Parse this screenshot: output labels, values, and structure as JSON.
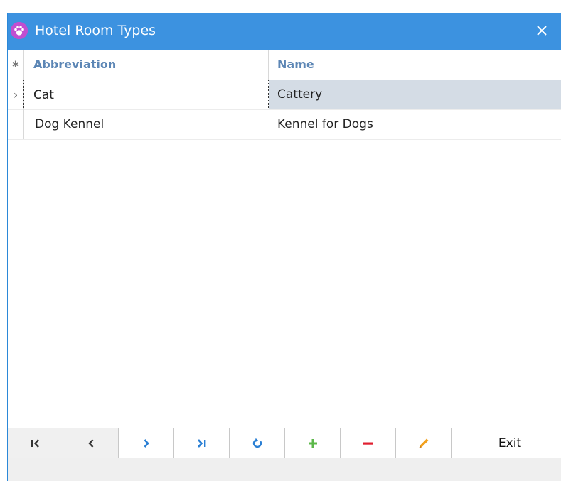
{
  "window": {
    "title": "Hotel Room Types",
    "icon": "paw-icon",
    "close_icon": "close-icon",
    "titlebar_color": "#3c92e0"
  },
  "grid": {
    "columns": [
      "Abbreviation",
      "Name"
    ],
    "header_indicator": "✱",
    "rows": [
      {
        "indicator": "›",
        "abbreviation": "Cat",
        "name": "Cattery",
        "selected": true
      },
      {
        "indicator": "",
        "abbreviation": "Dog Kennel",
        "name": "Kennel for Dogs",
        "selected": false
      }
    ],
    "selection_color": "#d4dce5"
  },
  "navigator": {
    "buttons": [
      {
        "name": "first-record-icon",
        "glyph": "I‹"
      },
      {
        "name": "prior-record-icon",
        "glyph": "‹"
      },
      {
        "name": "next-record-icon",
        "glyph": "›"
      },
      {
        "name": "last-record-icon",
        "glyph": "›I"
      },
      {
        "name": "refresh-icon",
        "glyph": "↻"
      },
      {
        "name": "add-icon",
        "glyph": "+"
      },
      {
        "name": "delete-icon",
        "glyph": "−"
      },
      {
        "name": "edit-pencil-icon",
        "glyph": "✎"
      }
    ],
    "exit_label": "Exit",
    "accent_blue": "#2a7fd4",
    "add_green": "#5cb84a",
    "delete_red": "#e02030",
    "edit_orange": "#f2a01c"
  }
}
